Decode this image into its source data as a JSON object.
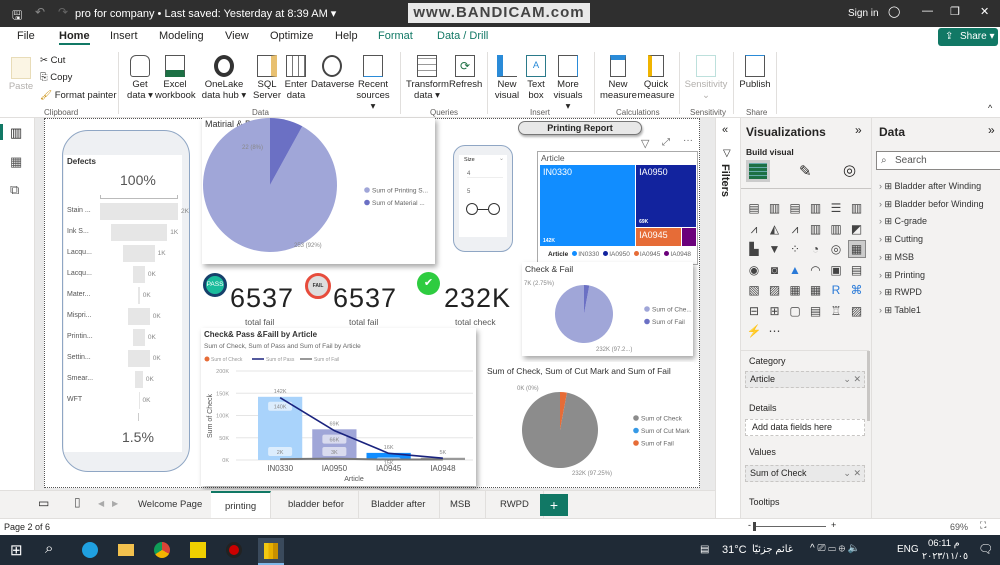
{
  "titlebar": {
    "file": "pro for company",
    "saved": "• Last saved: Yesterday at 8:39 AM",
    "watermark": "www.BANDICAM.com",
    "signin": "Sign in"
  },
  "menu": [
    "File",
    "Home",
    "Insert",
    "Modeling",
    "View",
    "Optimize",
    "Help",
    "Format",
    "Data / Drill"
  ],
  "share": "Share",
  "ribbon": {
    "paste": "Paste",
    "cut": "Cut",
    "copy": "Copy",
    "format_painter": "Format painter",
    "clipboard": "Clipboard",
    "get_data": "Get data",
    "excel": "Excel workbook",
    "onelake": "OneLake data hub",
    "sql": "SQL Server",
    "enter": "Enter data",
    "dataverse": "Dataverse",
    "recent": "Recent sources",
    "data_group": "Data",
    "transform": "Transform data",
    "refresh": "Refresh",
    "queries": "Queries",
    "new_visual": "New visual",
    "text_box": "Text box",
    "more_visuals": "More visuals",
    "insert": "Insert",
    "new_measure": "New measure",
    "quick_measure": "Quick measure",
    "calculations": "Calculations",
    "sensitivity": "Sensitivity",
    "sensitivity_group": "Sensitivity",
    "publish": "Publish",
    "share_group": "Share"
  },
  "report": {
    "printing_report": "Printing Report",
    "defects_title": "Defects",
    "funnel_top": "100%",
    "funnel_bottom": "1.5%",
    "kpis": [
      {
        "value": "6537",
        "label": "total fail",
        "badge": "PASS"
      },
      {
        "value": "6537",
        "label": "total fail",
        "badge": "FAIL"
      },
      {
        "value": "232K",
        "label": "total check"
      }
    ],
    "slicer": {
      "title": "Size",
      "options": [
        "4",
        "5"
      ]
    }
  },
  "chart_data": [
    {
      "id": "defects",
      "type": "funnel",
      "title": "Defects",
      "categories": [
        "Stain ...",
        "Ink S...",
        "Lacqu...",
        "Lacqu...",
        "Mater...",
        "Mispri...",
        "Printin...",
        "Settin...",
        "Smear...",
        "WFT"
      ],
      "labels": [
        "2K",
        "1K",
        "1K",
        "0K",
        "0K",
        "0K",
        "0K",
        "0K",
        "0K",
        "0K"
      ],
      "values": [
        2000,
        1450,
        800,
        300,
        40,
        550,
        300,
        550,
        200,
        20
      ]
    },
    {
      "id": "material-printing",
      "type": "pie",
      "title": "Matirial & Printing",
      "series": [
        {
          "name": "Sum of Printing S...",
          "value": 253,
          "label": "253 (92%)",
          "color": "#a0a6d8"
        },
        {
          "name": "Sum of Material ...",
          "value": 22,
          "label": "22 (8%)",
          "color": "#6b70c4"
        }
      ]
    },
    {
      "id": "article-treemap",
      "type": "treemap",
      "title": "Article",
      "legend_title": "Article",
      "categories": [
        "IN0330",
        "IA0950",
        "IA0945",
        "IA0948"
      ],
      "values": [
        142,
        69,
        16,
        5
      ],
      "labels": [
        "142K",
        "69K",
        "",
        ""
      ],
      "colors": [
        "#118dff",
        "#12239e",
        "#e66c37",
        "#6b007b"
      ]
    },
    {
      "id": "check-fail",
      "type": "pie",
      "title": "Check & Fail",
      "series": [
        {
          "name": "Sum of Che...",
          "value": 232,
          "label": "232K (97.2...)",
          "color": "#a0a6d8"
        },
        {
          "name": "Sum of Fail",
          "value": 7,
          "label": "7K (2.75%)",
          "color": "#6b70c4"
        }
      ]
    },
    {
      "id": "check-pass-fail",
      "type": "bar",
      "title": "Check& Pass &Faill by Article",
      "subtitle": "Sum of Check, Sum of Pass and Sum of Fail by Article",
      "xlabel": "Article",
      "ylabel": "Sum of Check",
      "ylim": [
        0,
        200
      ],
      "yticks": [
        "0K",
        "50K",
        "100K",
        "150K",
        "200K"
      ],
      "grid": true,
      "legend": "top-left",
      "legend_items": [
        {
          "name": "Sum of Check",
          "color": "#e66c37",
          "kind": "dot"
        },
        {
          "name": "Sum of Pass",
          "color": "#1a237e",
          "kind": "line"
        },
        {
          "name": "Sum of Fail",
          "color": "#777777",
          "kind": "line"
        }
      ],
      "categories": [
        "IN0330",
        "IA0950",
        "IA0945",
        "IA0948"
      ],
      "bar_colors": [
        "#a9d3fb",
        "#a0a6d8",
        "#118dff",
        "#999999"
      ],
      "series": [
        {
          "name": "Sum of Check",
          "values": [
            142,
            69,
            16,
            5
          ],
          "labels": [
            "142K",
            "69K",
            "16K",
            "5K"
          ]
        },
        {
          "name": "Sum of Pass",
          "values": [
            140,
            66,
            15,
            4
          ],
          "labels": [
            "140K",
            "66K",
            "15K",
            ""
          ]
        },
        {
          "name": "Sum of Fail",
          "values": [
            2,
            3,
            1,
            1
          ],
          "labels": [
            "2K",
            "3K",
            "",
            ""
          ]
        }
      ]
    },
    {
      "id": "check-cut-fail",
      "type": "pie",
      "title": "Sum of Check, Sum of Cut Mark and Sum of Fail",
      "series": [
        {
          "name": "Sum of Check",
          "value": 232,
          "label": "232K (97.25%)",
          "color": "#8c8c8c"
        },
        {
          "name": "Sum of Cut Mark",
          "value": 0,
          "label": "",
          "color": "#3599e6"
        },
        {
          "name": "Sum of Fail",
          "value": 7,
          "label": "0K (0%)",
          "color": "#e66c37"
        }
      ]
    }
  ],
  "filters": "Filters",
  "viz": {
    "title": "Visualizations",
    "build": "Build visual",
    "category": "Category",
    "category_value": "Article",
    "details": "Details",
    "details_placeholder": "Add data fields here",
    "values": "Values",
    "values_value": "Sum of Check",
    "tooltips": "Tooltips",
    "icons": [
      "stacked-bar",
      "stacked-column",
      "clustered-bar",
      "clustered-column",
      "100-bar",
      "100-column",
      "line",
      "area",
      "stacked-area",
      "line-column",
      "line-clustered",
      "ribbon",
      "waterfall",
      "funnel",
      "scatter",
      "pie",
      "donut",
      "treemap",
      "map",
      "filled-map",
      "azure-map",
      "gauge",
      "card",
      "multi-row-card",
      "kpi",
      "slicer",
      "table",
      "matrix",
      "r-visual",
      "python-visual",
      "key-influencers",
      "decomposition-tree",
      "qa",
      "smart-narrative",
      "paginated",
      "metrics",
      "power-apps",
      "more"
    ]
  },
  "data": {
    "title": "Data",
    "search_placeholder": "Search",
    "tables": [
      "Bladder after Winding",
      "Bladder befor Winding",
      "C-grade",
      "Cutting",
      "MSB",
      "Printing",
      "RWPD",
      "Table1"
    ]
  },
  "tabs": [
    "Welcome Page",
    "printing",
    "bladder befor",
    "Bladder after",
    "MSB",
    "RWPD"
  ],
  "active_tab": 1,
  "status": {
    "page": "Page 2 of 6",
    "zoom": "69%",
    "zoom_level": 69
  },
  "taskbar": {
    "weather": "31°C",
    "weather_text": "غائم جزئيًا",
    "lang": "ENG",
    "time": "06:11 م",
    "date": "٢٠٢٣/١١/٠٥"
  }
}
